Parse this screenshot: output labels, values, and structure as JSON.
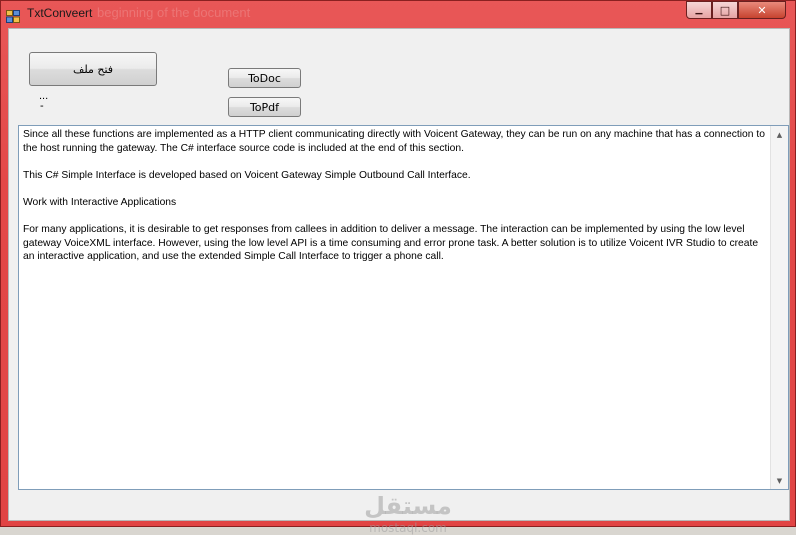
{
  "window": {
    "title": "TxtConveert",
    "ghost_title": "beginning of the document"
  },
  "controls": {
    "minimize_glyph": "▁",
    "maximize_glyph": "□",
    "close_glyph": "✕"
  },
  "buttons": {
    "open_file": "فتح ملف",
    "to_doc": "ToDoc",
    "to_pdf": "ToPdf"
  },
  "labels": {
    "file_name": "...",
    "status": "-"
  },
  "textbox": {
    "paragraphs": [
      "Since all these functions are implemented as a HTTP client communicating directly with Voicent Gateway, they can be run on any machine that has a connection to the host running the gateway. The C# interface source code is included at the end of this section.",
      "This C# Simple Interface is developed based on Voicent Gateway Simple Outbound Call Interface.",
      "Work with Interactive Applications",
      "For many applications, it is desirable to get responses from callees in addition to deliver a message. The interaction can be implemented by using the low level gateway VoiceXML interface. However, using the low level API is a time consuming and error prone task. A better solution is to utilize Voicent IVR Studio to create an interactive application, and use the extended Simple Call Interface to trigger a phone call."
    ]
  },
  "scrollbar": {
    "up_glyph": "▲",
    "down_glyph": "▼"
  },
  "watermark": {
    "arabic": "مستقل",
    "latin": "mostaql.com"
  },
  "colors": {
    "titlebar": "#e34848",
    "client_bg": "#f0f0f0",
    "textbox_border": "#7f9db9"
  }
}
